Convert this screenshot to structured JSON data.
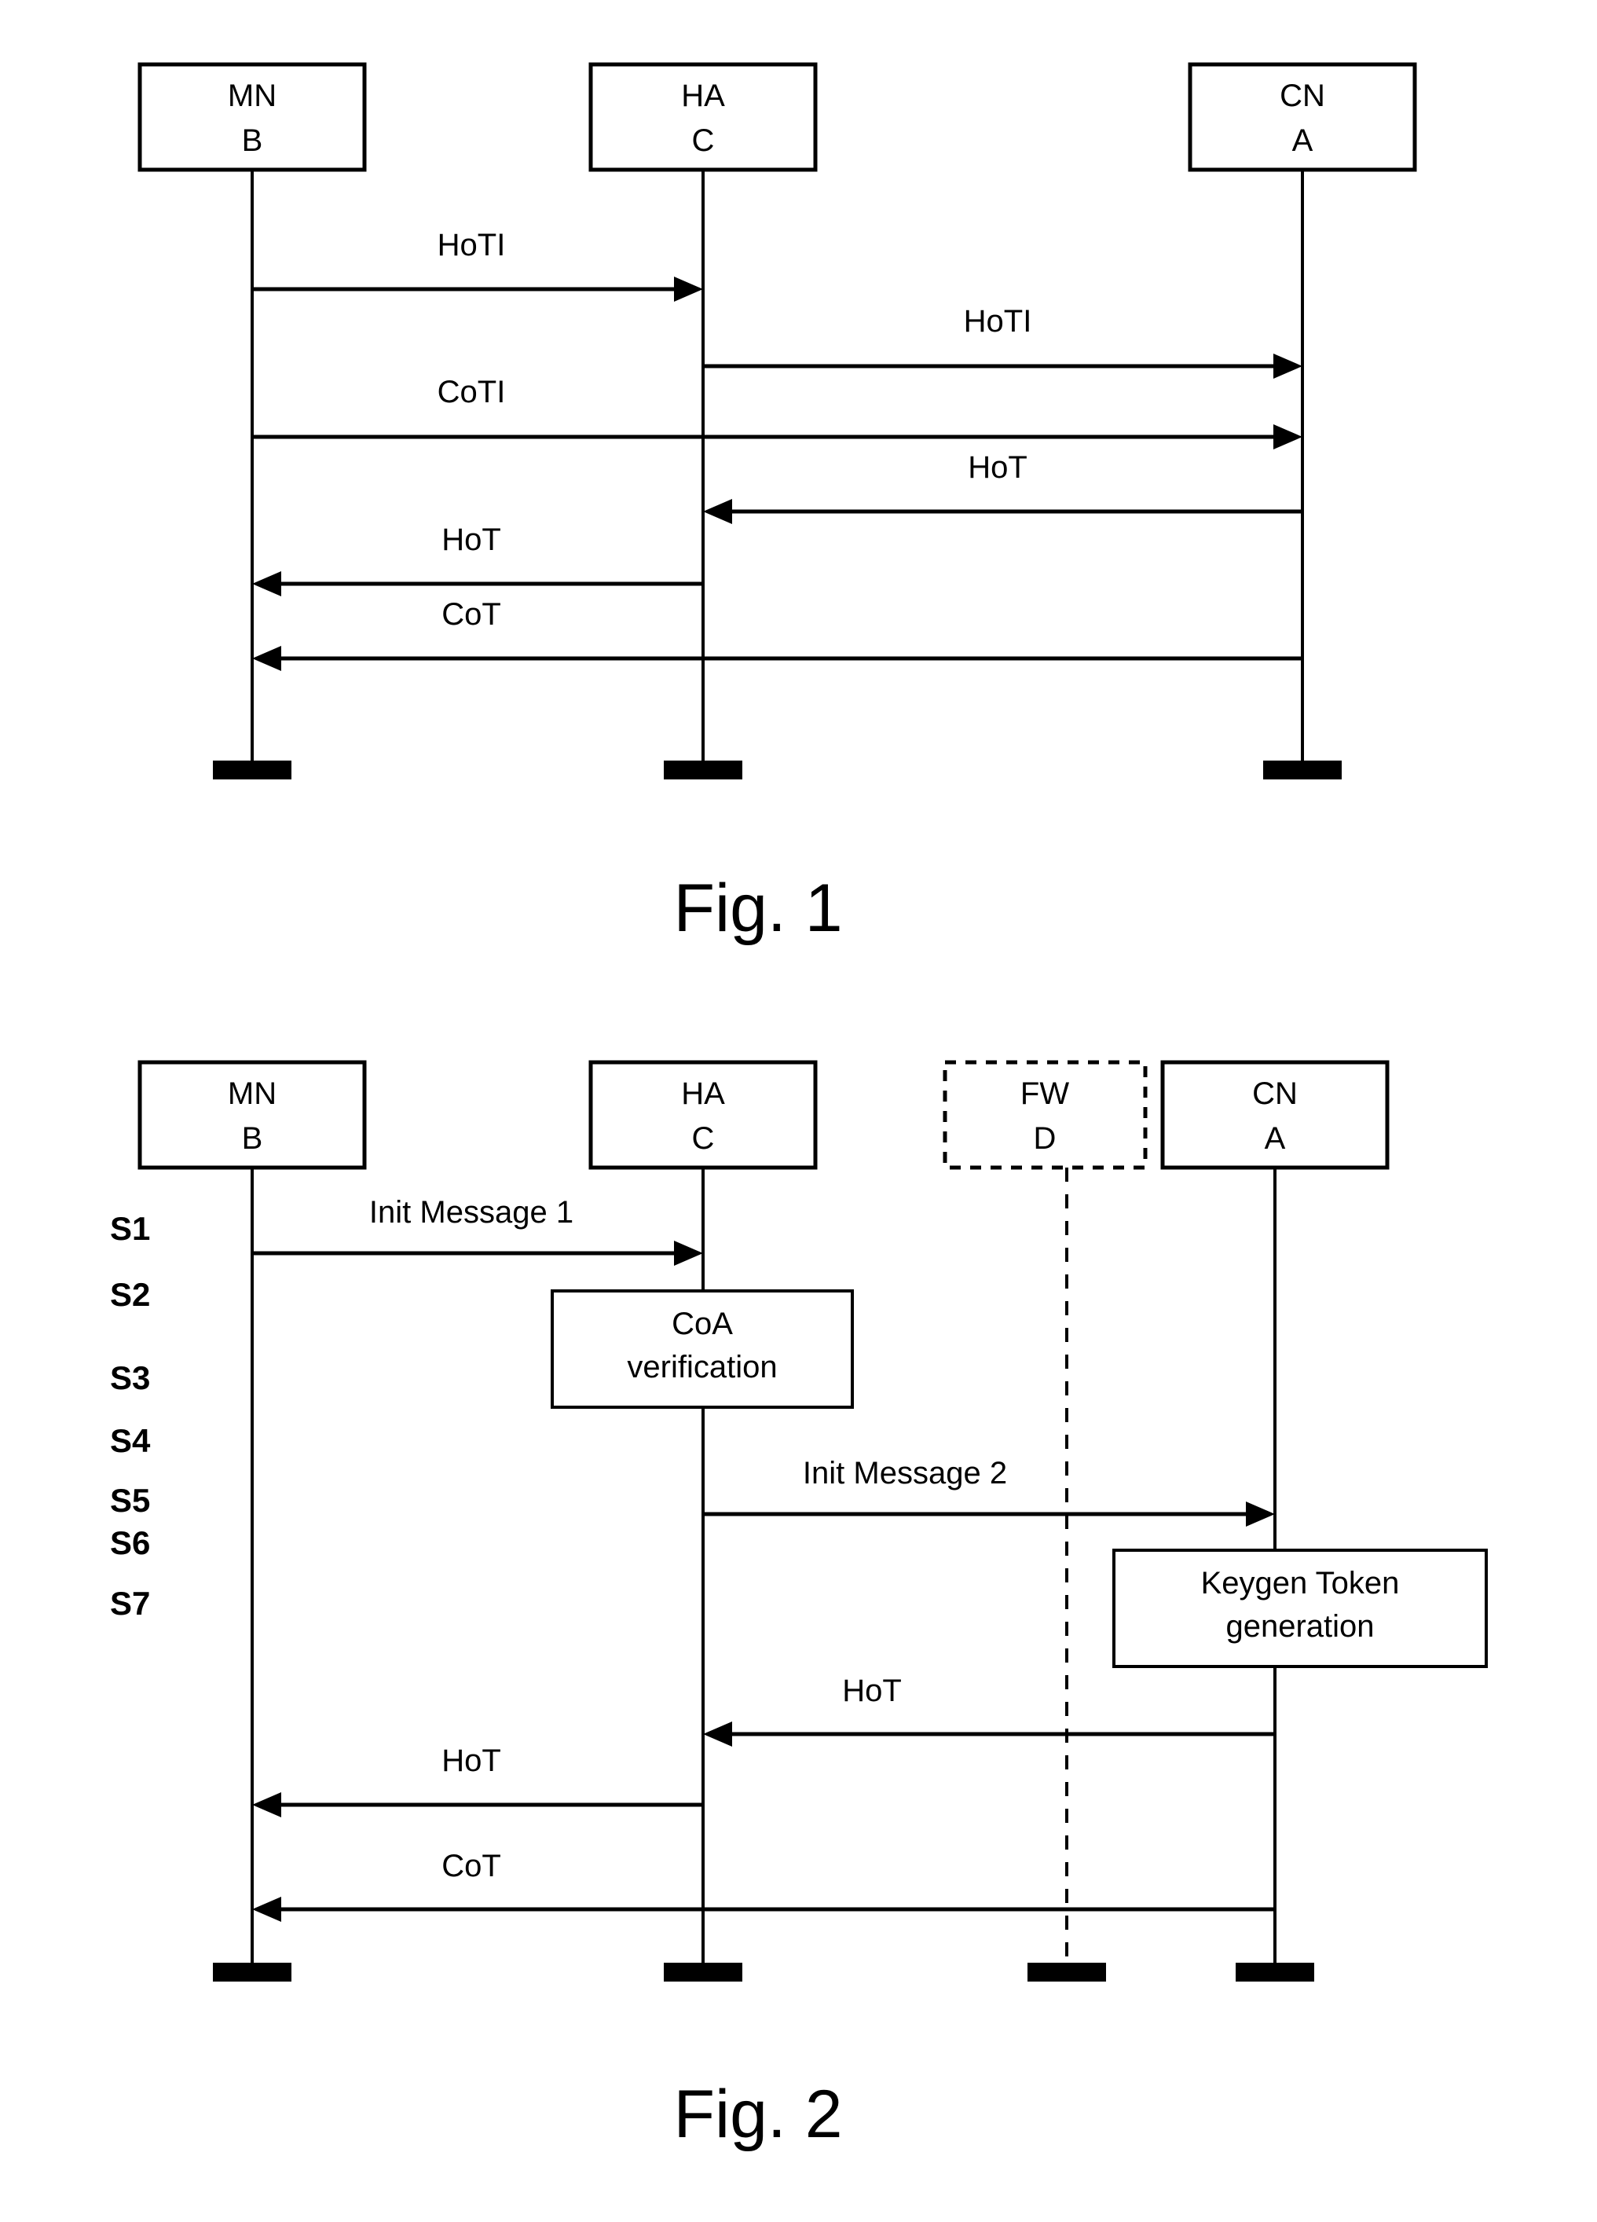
{
  "document": {
    "kind": "patent-drawing-sheet",
    "background_color": "#ffffff",
    "ink_color": "#000000"
  },
  "figure1": {
    "caption": "Fig. 1",
    "participants": [
      {
        "id": "mn",
        "name": "MN",
        "letter": "B"
      },
      {
        "id": "ha",
        "name": "HA",
        "letter": "C"
      },
      {
        "id": "cn",
        "name": "CN",
        "letter": "A"
      }
    ],
    "messages": [
      {
        "label": "HoTI",
        "from": "mn",
        "to": "ha",
        "direction": "right"
      },
      {
        "label": "HoTI",
        "from": "ha",
        "to": "cn",
        "direction": "right"
      },
      {
        "label": "CoTI",
        "from": "mn",
        "to": "cn",
        "direction": "right"
      },
      {
        "label": "HoT",
        "from": "cn",
        "to": "ha",
        "direction": "left"
      },
      {
        "label": "HoT",
        "from": "ha",
        "to": "mn",
        "direction": "left"
      },
      {
        "label": "CoT",
        "from": "cn",
        "to": "mn",
        "direction": "left"
      }
    ]
  },
  "figure2": {
    "caption": "Fig. 2",
    "participants": [
      {
        "id": "mn",
        "name": "MN",
        "letter": "B",
        "style": "solid"
      },
      {
        "id": "ha",
        "name": "HA",
        "letter": "C",
        "style": "solid"
      },
      {
        "id": "fw",
        "name": "FW",
        "letter": "D",
        "style": "dashed"
      },
      {
        "id": "cn",
        "name": "CN",
        "letter": "A",
        "style": "solid"
      }
    ],
    "steps": [
      {
        "id": "S1",
        "label": "S1"
      },
      {
        "id": "S2",
        "label": "S2"
      },
      {
        "id": "S3",
        "label": "S3"
      },
      {
        "id": "S4",
        "label": "S4"
      },
      {
        "id": "S5",
        "label": "S5"
      },
      {
        "id": "S6",
        "label": "S6"
      },
      {
        "id": "S7",
        "label": "S7"
      }
    ],
    "messages": [
      {
        "step": "S1",
        "label": "Init Message 1",
        "from": "mn",
        "to": "ha",
        "direction": "right"
      },
      {
        "step": "S3",
        "label": "Init Message 2",
        "from": "ha",
        "to": "cn",
        "direction": "right"
      },
      {
        "step": "S5",
        "label": "HoT",
        "from": "cn",
        "to": "ha",
        "direction": "left"
      },
      {
        "step": "S6",
        "label": "HoT",
        "from": "ha",
        "to": "mn",
        "direction": "left"
      },
      {
        "step": "S7",
        "label": "CoT",
        "from": "cn",
        "to": "mn",
        "direction": "left"
      }
    ],
    "activities": [
      {
        "step": "S2",
        "on": "ha",
        "line1": "CoA",
        "line2": "verification"
      },
      {
        "step": "S4",
        "on": "cn",
        "line1": "Keygen Token",
        "line2": "generation"
      }
    ]
  }
}
